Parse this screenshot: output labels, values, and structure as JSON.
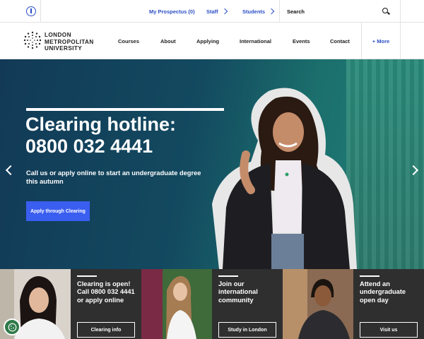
{
  "topbar": {
    "accessibility_icon": "accessibility-icon",
    "links": [
      {
        "label": "My Prospectus (0)"
      },
      {
        "label": "Staff"
      },
      {
        "label": "Students"
      }
    ],
    "search_placeholder": "Search",
    "search_icon": "search-icon"
  },
  "nav": {
    "logo": {
      "line1": "LONDON",
      "line2": "METROPOLITAN",
      "line3": "UNIVERSITY"
    },
    "items": [
      {
        "label": "Courses"
      },
      {
        "label": "About"
      },
      {
        "label": "Applying"
      },
      {
        "label": "International"
      },
      {
        "label": "Events"
      },
      {
        "label": "Contact"
      }
    ],
    "more_label": "+ More"
  },
  "hero": {
    "title_line1": "Clearing hotline:",
    "title_line2": "0800 032 4441",
    "subtitle": "Call us or apply online to start an undergraduate degree this autumn",
    "cta_label": "Apply through Clearing",
    "prev_icon": "chevron-left-icon",
    "next_icon": "chevron-right-icon",
    "colors": {
      "overlay": "#123a57",
      "accent": "#3a5ef0",
      "building": "#2a8a7a"
    }
  },
  "cards": [
    {
      "title": "Clearing is open! Call 0800 032 4441 or apply online",
      "button": "Clearing info"
    },
    {
      "title": "Join our international community",
      "button": "Study in London"
    },
    {
      "title": "Attend an undergraduate open day",
      "button": "Visit us"
    }
  ],
  "cookie_icon": "cookie-icon"
}
